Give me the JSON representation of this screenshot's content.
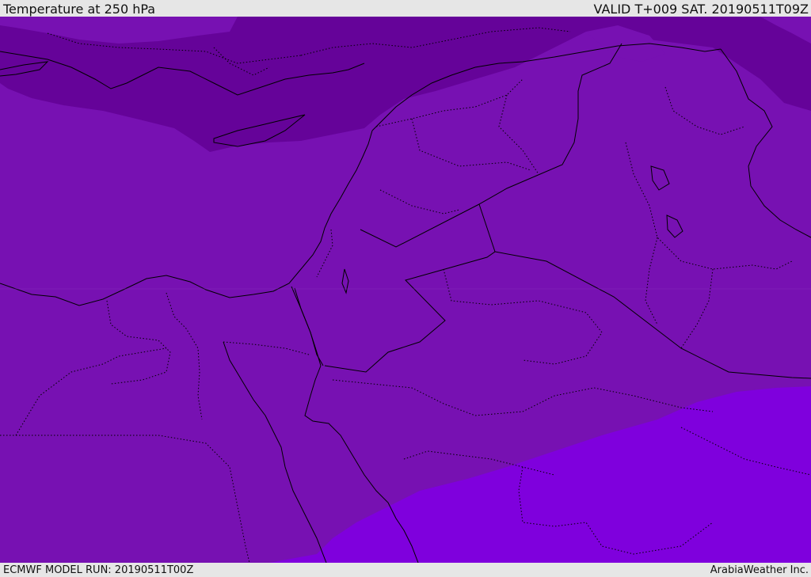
{
  "header": {
    "title": "Temperature at 250 hPa",
    "valid": "VALID T+009 SAT. 20190511T09Z"
  },
  "footer": {
    "model_run": "ECMWF MODEL RUN: 20190511T00Z",
    "credit": "ArabiaWeather Inc."
  },
  "colors": {
    "cold_band": "#650399",
    "main_field": "#7711b2",
    "warm_band": "#7f00dd",
    "coastline": "#000000",
    "background": "#e6e6e6"
  }
}
